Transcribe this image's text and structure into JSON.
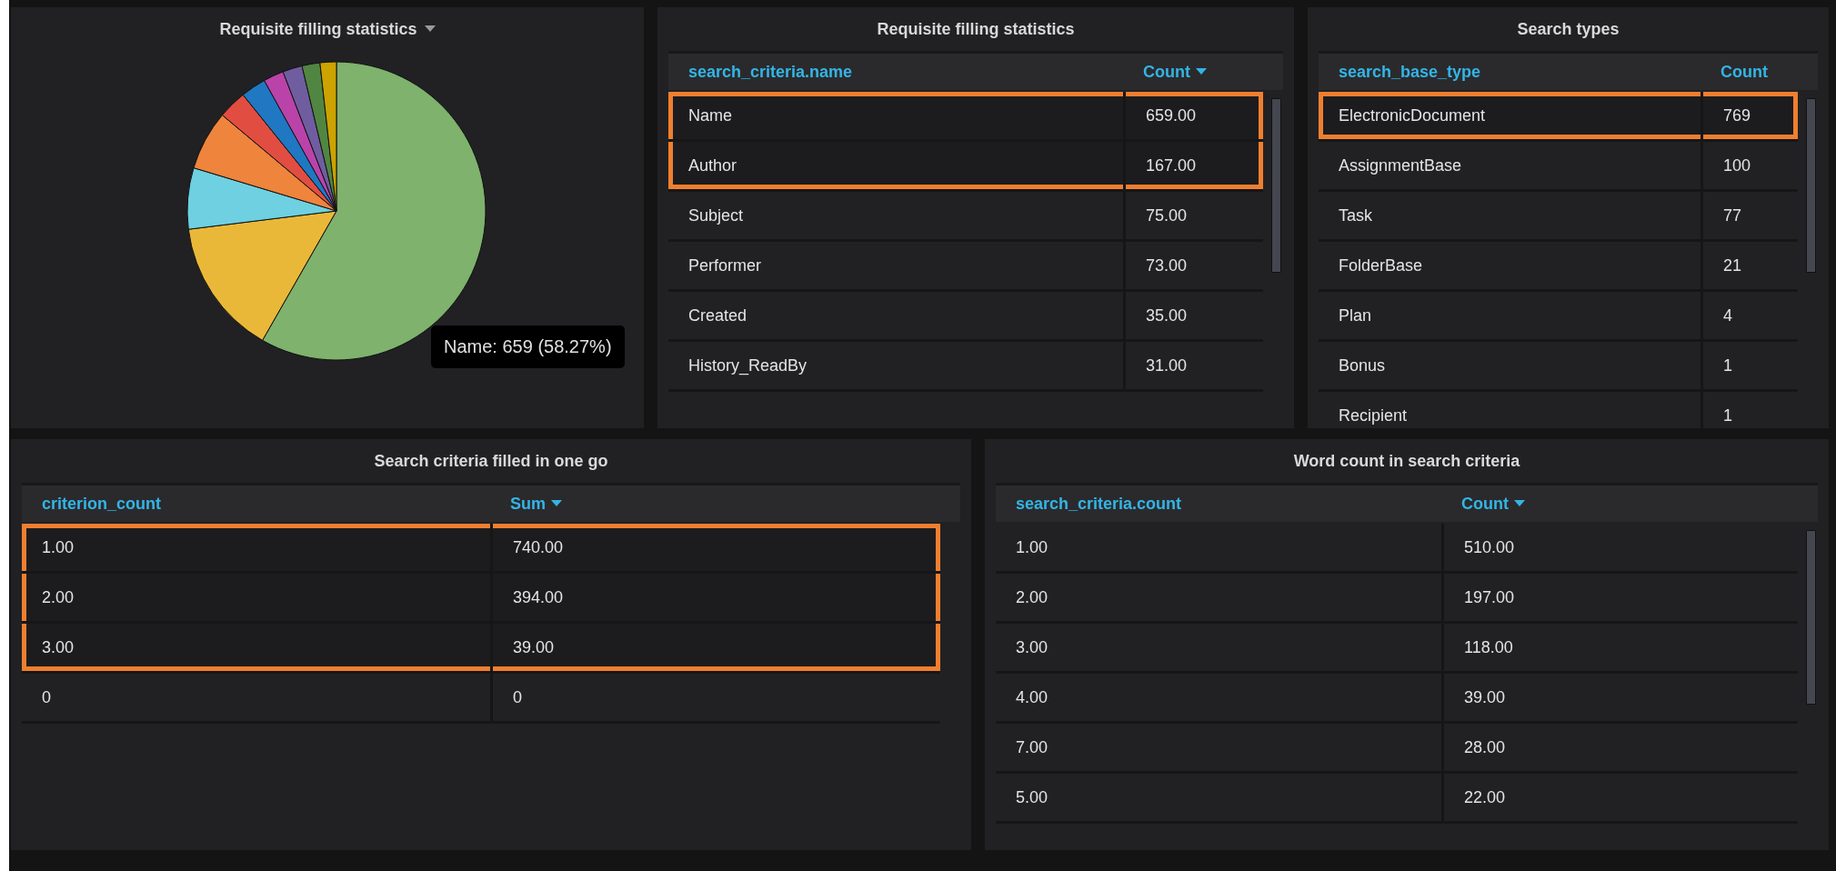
{
  "pie_panel": {
    "title": "Requisite filling statistics",
    "menu": true,
    "tooltip": "Name: 659 (58.27%)"
  },
  "tables": [
    {
      "title": "Requisite filling statistics",
      "scrollbar": true,
      "columns": [
        {
          "label": "search_criteria.name",
          "sorted": false
        },
        {
          "label": "Count",
          "sorted": true
        }
      ],
      "rows": [
        {
          "cells": [
            "Name",
            "659.00"
          ],
          "highlighted": true
        },
        {
          "cells": [
            "Author",
            "167.00"
          ],
          "highlighted": true
        },
        {
          "cells": [
            "Subject",
            "75.00"
          ],
          "highlighted": false
        },
        {
          "cells": [
            "Performer",
            "73.00"
          ],
          "highlighted": false
        },
        {
          "cells": [
            "Created",
            "35.00"
          ],
          "highlighted": false
        },
        {
          "cells": [
            "History_ReadBy",
            "31.00"
          ],
          "highlighted": false
        }
      ]
    },
    {
      "title": "Search types",
      "scrollbar": true,
      "columns": [
        {
          "label": "search_base_type",
          "sorted": false
        },
        {
          "label": "Count",
          "sorted": false
        }
      ],
      "rows": [
        {
          "cells": [
            "ElectronicDocument",
            "769"
          ],
          "highlighted": true
        },
        {
          "cells": [
            "AssignmentBase",
            "100"
          ],
          "highlighted": false
        },
        {
          "cells": [
            "Task",
            "77"
          ],
          "highlighted": false
        },
        {
          "cells": [
            "FolderBase",
            "21"
          ],
          "highlighted": false
        },
        {
          "cells": [
            "Plan",
            "4"
          ],
          "highlighted": false
        },
        {
          "cells": [
            "Bonus",
            "1"
          ],
          "highlighted": false
        },
        {
          "cells": [
            "Recipient",
            "1"
          ],
          "highlighted": false
        }
      ]
    },
    {
      "title": "Search criteria filled in one go",
      "scrollbar": false,
      "columns": [
        {
          "label": "criterion_count",
          "sorted": false
        },
        {
          "label": "Sum",
          "sorted": true
        }
      ],
      "rows": [
        {
          "cells": [
            "1.00",
            "740.00"
          ],
          "highlighted": true
        },
        {
          "cells": [
            "2.00",
            "394.00"
          ],
          "highlighted": true
        },
        {
          "cells": [
            "3.00",
            "39.00"
          ],
          "highlighted": true
        },
        {
          "cells": [
            "0",
            "0"
          ],
          "highlighted": false
        }
      ]
    },
    {
      "title": "Word count in search criteria",
      "scrollbar": true,
      "columns": [
        {
          "label": "search_criteria.count",
          "sorted": false
        },
        {
          "label": "Count",
          "sorted": true
        }
      ],
      "rows": [
        {
          "cells": [
            "1.00",
            "510.00"
          ],
          "highlighted": false
        },
        {
          "cells": [
            "2.00",
            "197.00"
          ],
          "highlighted": false
        },
        {
          "cells": [
            "3.00",
            "118.00"
          ],
          "highlighted": false
        },
        {
          "cells": [
            "4.00",
            "39.00"
          ],
          "highlighted": false
        },
        {
          "cells": [
            "7.00",
            "28.00"
          ],
          "highlighted": false
        },
        {
          "cells": [
            "5.00",
            "22.00"
          ],
          "highlighted": false
        }
      ]
    }
  ]
}
